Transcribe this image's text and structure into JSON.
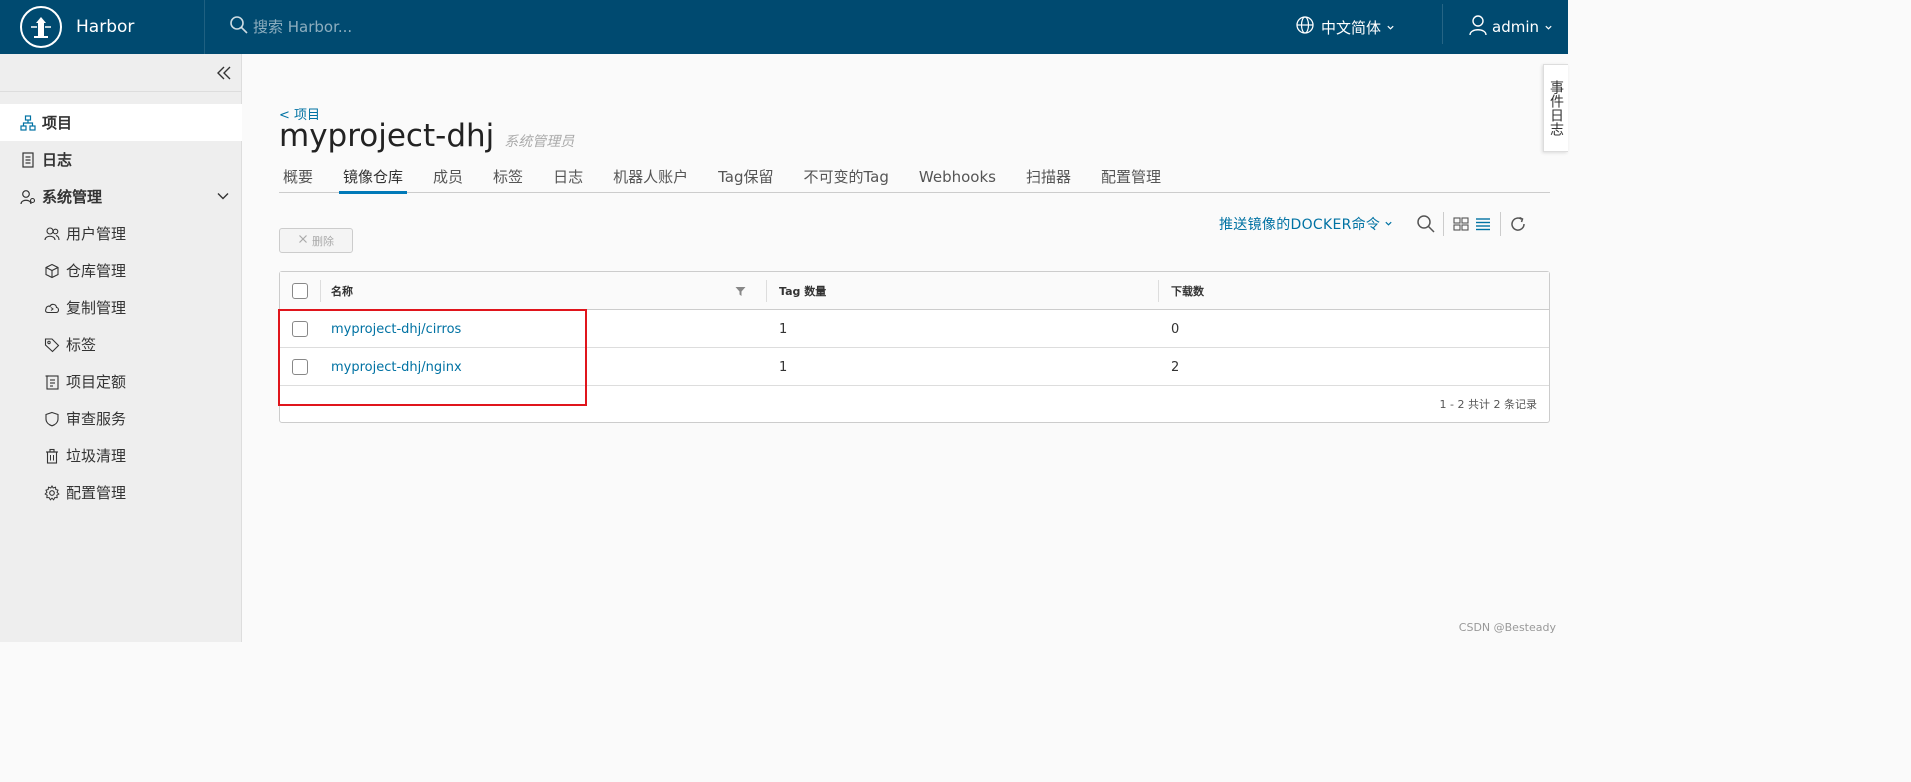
{
  "header": {
    "app_title": "Harbor",
    "search_placeholder": "搜索 Harbor...",
    "language": "中文简体",
    "user": "admin"
  },
  "sidebar": {
    "items": [
      {
        "label": "项目",
        "icon": "project-icon",
        "level": "top",
        "active": true
      },
      {
        "label": "日志",
        "icon": "log-icon",
        "level": "top"
      },
      {
        "label": "系统管理",
        "icon": "admin-icon",
        "level": "top",
        "expanded": true
      },
      {
        "label": "用户管理",
        "icon": "users-icon",
        "level": "sub"
      },
      {
        "label": "仓库管理",
        "icon": "registry-icon",
        "level": "sub"
      },
      {
        "label": "复制管理",
        "icon": "replication-icon",
        "level": "sub"
      },
      {
        "label": "标签",
        "icon": "tag-icon",
        "level": "sub"
      },
      {
        "label": "项目定额",
        "icon": "quota-icon",
        "level": "sub"
      },
      {
        "label": "审查服务",
        "icon": "shield-icon",
        "level": "sub"
      },
      {
        "label": "垃圾清理",
        "icon": "trash-icon",
        "level": "sub"
      },
      {
        "label": "配置管理",
        "icon": "gear-icon",
        "level": "sub"
      }
    ]
  },
  "main": {
    "breadcrumb": "< 项目",
    "title": "myproject-dhj",
    "role": "系统管理员",
    "tabs": [
      {
        "label": "概要"
      },
      {
        "label": "镜像仓库",
        "active": true
      },
      {
        "label": "成员"
      },
      {
        "label": "标签"
      },
      {
        "label": "日志"
      },
      {
        "label": "机器人账户"
      },
      {
        "label": "Tag保留"
      },
      {
        "label": "不可变的Tag"
      },
      {
        "label": "Webhooks"
      },
      {
        "label": "扫描器"
      },
      {
        "label": "配置管理"
      }
    ],
    "push_command": "推送镜像的DOCKER命令",
    "delete_label": "删除",
    "table": {
      "columns": [
        "名称",
        "Tag 数量",
        "下载数"
      ],
      "rows": [
        {
          "name": "myproject-dhj/cirros",
          "tags": "1",
          "pulls": "0"
        },
        {
          "name": "myproject-dhj/nginx",
          "tags": "1",
          "pulls": "2"
        }
      ],
      "footer": "1 - 2 共计 2 条记录"
    }
  },
  "event_tab": "事件日志",
  "watermark": "CSDN @Besteady",
  "colors": {
    "header_bg": "#004a70",
    "accent": "#0079b8",
    "link": "#0072a3",
    "highlight": "#e0151c"
  }
}
